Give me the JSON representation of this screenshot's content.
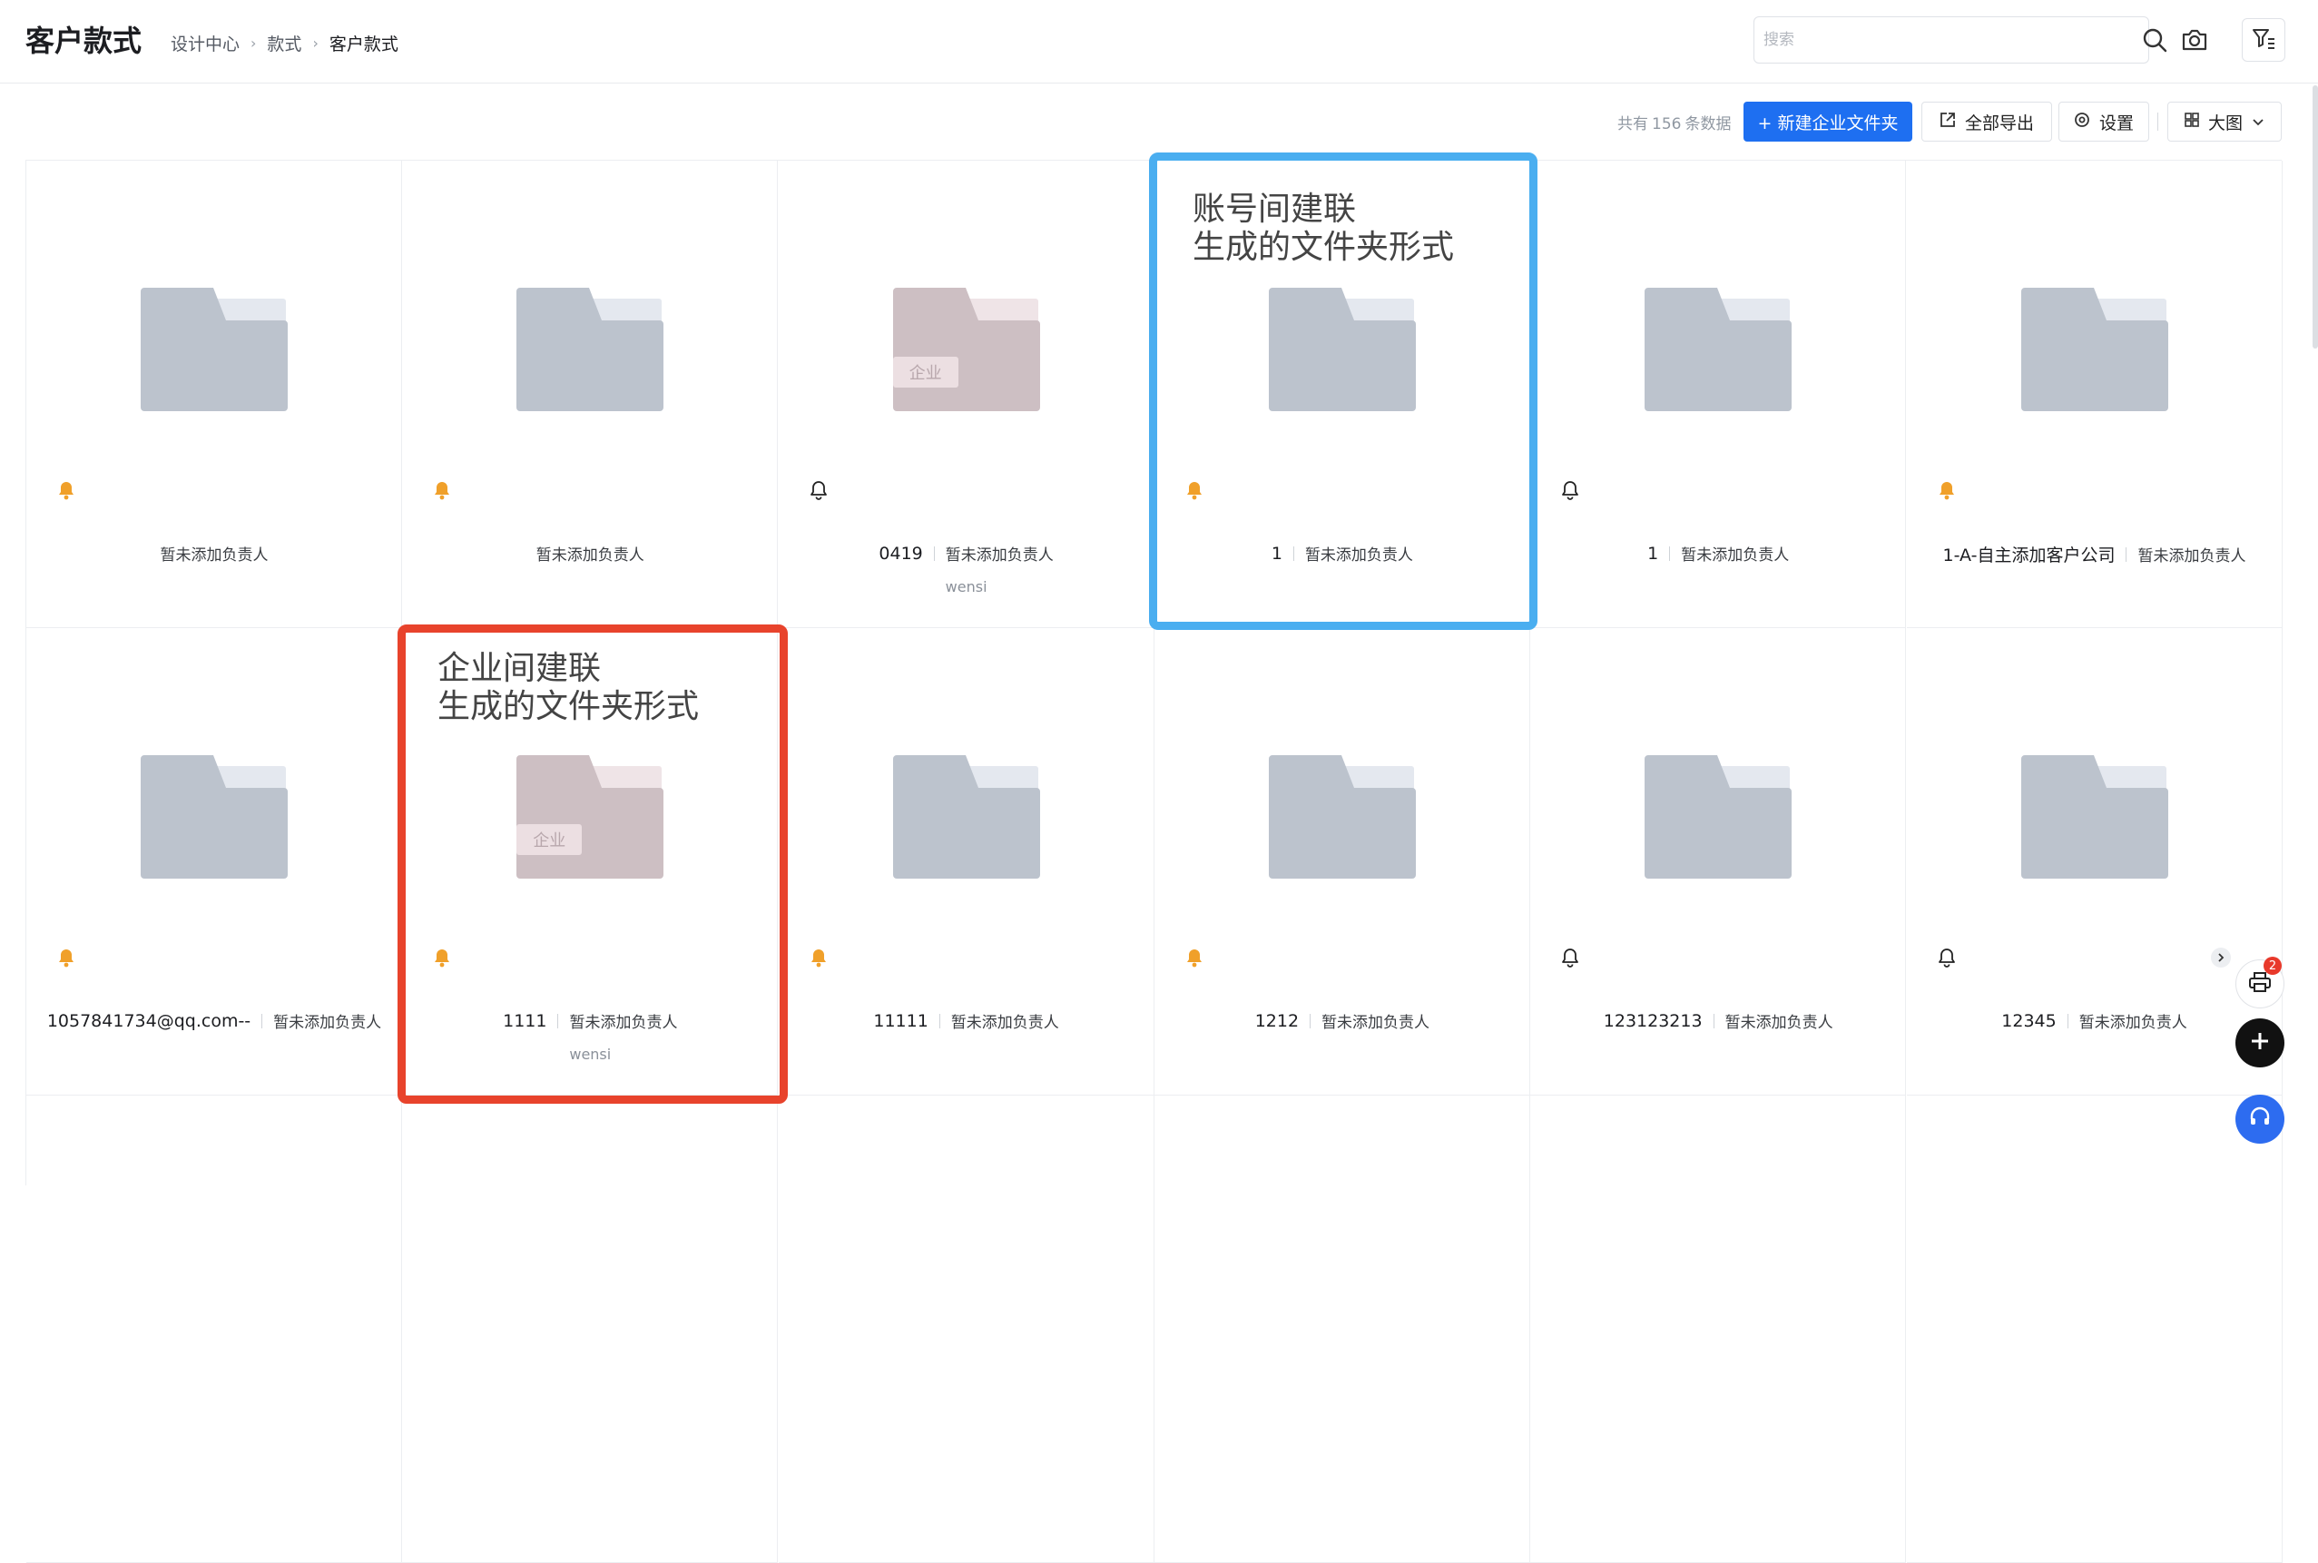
{
  "header": {
    "title": "客户款式",
    "breadcrumb": [
      "设计中心",
      "款式",
      "客户款式"
    ],
    "search_placeholder": "搜索"
  },
  "toolbar": {
    "count_prefix": "共有",
    "count": "156",
    "count_suffix": "条数据",
    "new_folder_label": "+ 新建企业文件夹",
    "export_label": "全部导出",
    "settings_label": "设置",
    "view_label": "大图"
  },
  "annotations": {
    "account_link": [
      "账号间建联",
      "生成的文件夹形式"
    ],
    "enterprise_link": [
      "企业间建联",
      "生成的文件夹形式"
    ],
    "account_link_color": "#4aaef0",
    "enterprise_link_color": "#e8432c"
  },
  "colors": {
    "folder_gray": "#bcc3cd",
    "folder_gray_tab": "#e4e8ef",
    "folder_pink": "#cdbfc3",
    "folder_pink_tab": "#efe4e7",
    "bell_orange": "#f0a02a",
    "primary": "#1e6ff1"
  },
  "enterprise_tag": "企业",
  "items": [
    {
      "name": "",
      "owner": "暂未添加负责人",
      "sub": "",
      "style": "gray",
      "bell": "filled"
    },
    {
      "name": "",
      "owner": "暂未添加负责人",
      "sub": "",
      "style": "gray",
      "bell": "filled"
    },
    {
      "name": "0419",
      "owner": "暂未添加负责人",
      "sub": "wensi",
      "style": "pink",
      "bell": "outline"
    },
    {
      "name": "1",
      "owner": "暂未添加负责人",
      "sub": "",
      "style": "gray",
      "bell": "filled"
    },
    {
      "name": "1",
      "owner": "暂未添加负责人",
      "sub": "",
      "style": "gray",
      "bell": "outline"
    },
    {
      "name": "1-A-自主添加客户公司",
      "owner": "暂未添加负责人",
      "sub": "",
      "style": "gray",
      "bell": "filled"
    },
    {
      "name": "1057841734@qq.com--",
      "owner": "暂未添加负责人",
      "sub": "",
      "style": "gray",
      "bell": "filled"
    },
    {
      "name": "1111",
      "owner": "暂未添加负责人",
      "sub": "wensi",
      "style": "pink",
      "bell": "filled"
    },
    {
      "name": "11111",
      "owner": "暂未添加负责人",
      "sub": "",
      "style": "gray",
      "bell": "filled"
    },
    {
      "name": "1212",
      "owner": "暂未添加负责人",
      "sub": "",
      "style": "gray",
      "bell": "filled"
    },
    {
      "name": "123123213",
      "owner": "暂未添加负责人",
      "sub": "",
      "style": "gray",
      "bell": "outline"
    },
    {
      "name": "12345",
      "owner": "暂未添加负责人",
      "sub": "",
      "style": "gray",
      "bell": "outline"
    }
  ],
  "float": {
    "print_badge": "2"
  }
}
